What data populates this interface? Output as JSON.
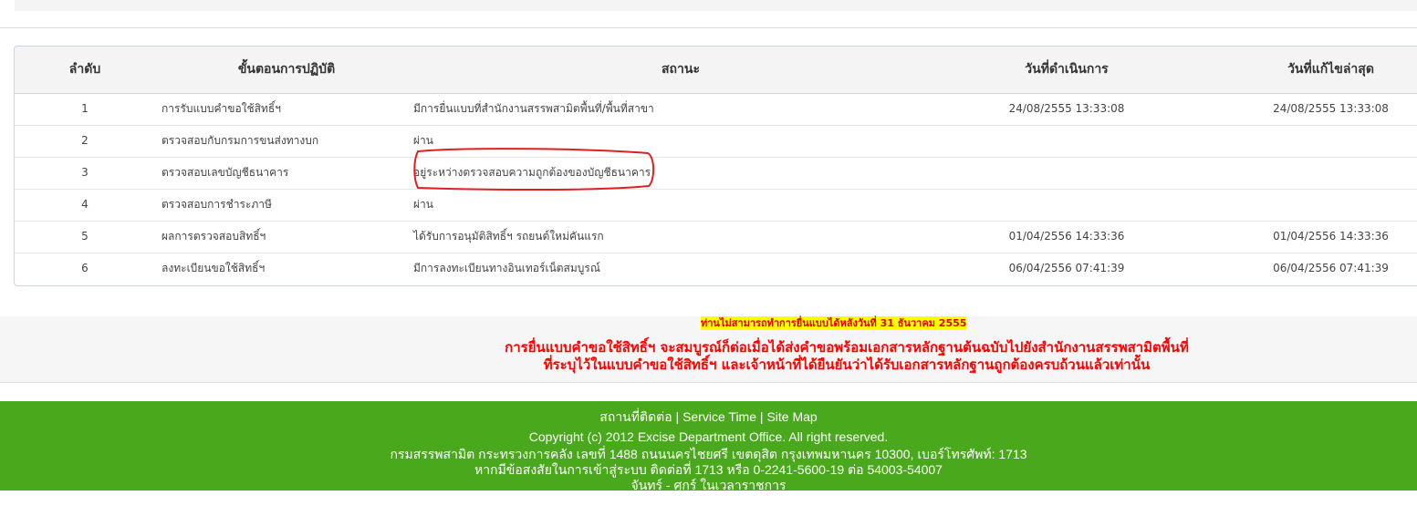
{
  "table": {
    "headers": {
      "no": "ลำดับ",
      "step": "ขั้นตอนการปฏิบัติ",
      "status": "สถานะ",
      "date": "วันที่ดำเนินการ",
      "modified": "วันที่แก้ไขล่าสุด"
    },
    "rows": [
      {
        "no": "1",
        "step": "การรับแบบคำขอใช้สิทธิ์ฯ",
        "status": "มีการยื่นแบบที่สำนักงานสรรพสามิตพื้นที่/พื้นที่สาขา",
        "date": "24/08/2555 13:33:08",
        "modified": "24/08/2555 13:33:08"
      },
      {
        "no": "2",
        "step": "ตรวจสอบกับกรมการขนส่งทางบก",
        "status": "ผ่าน",
        "date": "",
        "modified": ""
      },
      {
        "no": "3",
        "step": "ตรวจสอบเลขบัญชีธนาคาร",
        "status": "อยู่ระหว่างตรวจสอบความถูกต้องของบัญชีธนาคาร",
        "date": "",
        "modified": ""
      },
      {
        "no": "4",
        "step": "ตรวจสอบการชำระภาษี",
        "status": "ผ่าน",
        "date": "",
        "modified": ""
      },
      {
        "no": "5",
        "step": "ผลการตรวจสอบสิทธิ์ฯ",
        "status": "ได้รับการอนุมัติสิทธิ์ฯ รถยนต์ใหม่คันแรก",
        "date": "01/04/2556 14:33:36",
        "modified": "01/04/2556 14:33:36"
      },
      {
        "no": "6",
        "step": "ลงทะเบียนขอใช้สิทธิ์ฯ",
        "status": "มีการลงทะเบียนทางอินเทอร์เน็ตสมบูรณ์",
        "date": "06/04/2556 07:41:39",
        "modified": "06/04/2556 07:41:39"
      }
    ]
  },
  "notice": {
    "deadline": "ท่านไม่สามารถทำการยื่นแบบได้หลังวันที่ 31 ธันวาคม 2555",
    "line1": "การยื่นแบบคำขอใช้สิทธิ์ฯ จะสมบูรณ์ก็ต่อเมื่อได้ส่งคำขอพร้อมเอกสารหลักฐานต้นฉบับไปยังสำนักงานสรรพสามิตพื้นที่",
    "line2": "ที่ระบุไว้ในแบบคำขอใช้สิทธิ์ฯ และเจ้าหน้าที่ได้ยืนยันว่าได้รับเอกสารหลักฐานถูกต้องครบถ้วนแล้วเท่านั้น"
  },
  "footer": {
    "contact": "สถานที่ติดต่อ",
    "sep1": " | ",
    "service_time": "Service Time",
    "sep2": " | ",
    "site_map": "Site Map",
    "copyright": "Copyright (c) 2012 Excise Department Office. All right reserved.",
    "address": "กรมสรรพสามิต กระทรวงการคลัง เลขที่ 1488 ถนนนครไชยศรี เขตดุสิต กรุงเทพมหานคร 10300, เบอร์โทรศัพท์: 1713",
    "help": "หากมีข้อสงสัยในการเข้าสู่ระบบ ติดต่อที่ 1713 หรือ 0-2241-5600-19 ต่อ 54003-54007",
    "hours": "จันทร์ - ศุกร์ ในเวลาราชการ"
  },
  "colors": {
    "footer_bg": "#4aa81c",
    "warning_text": "#ff0000",
    "highlight_bg": "#ffff00",
    "annotation": "#e02020"
  }
}
